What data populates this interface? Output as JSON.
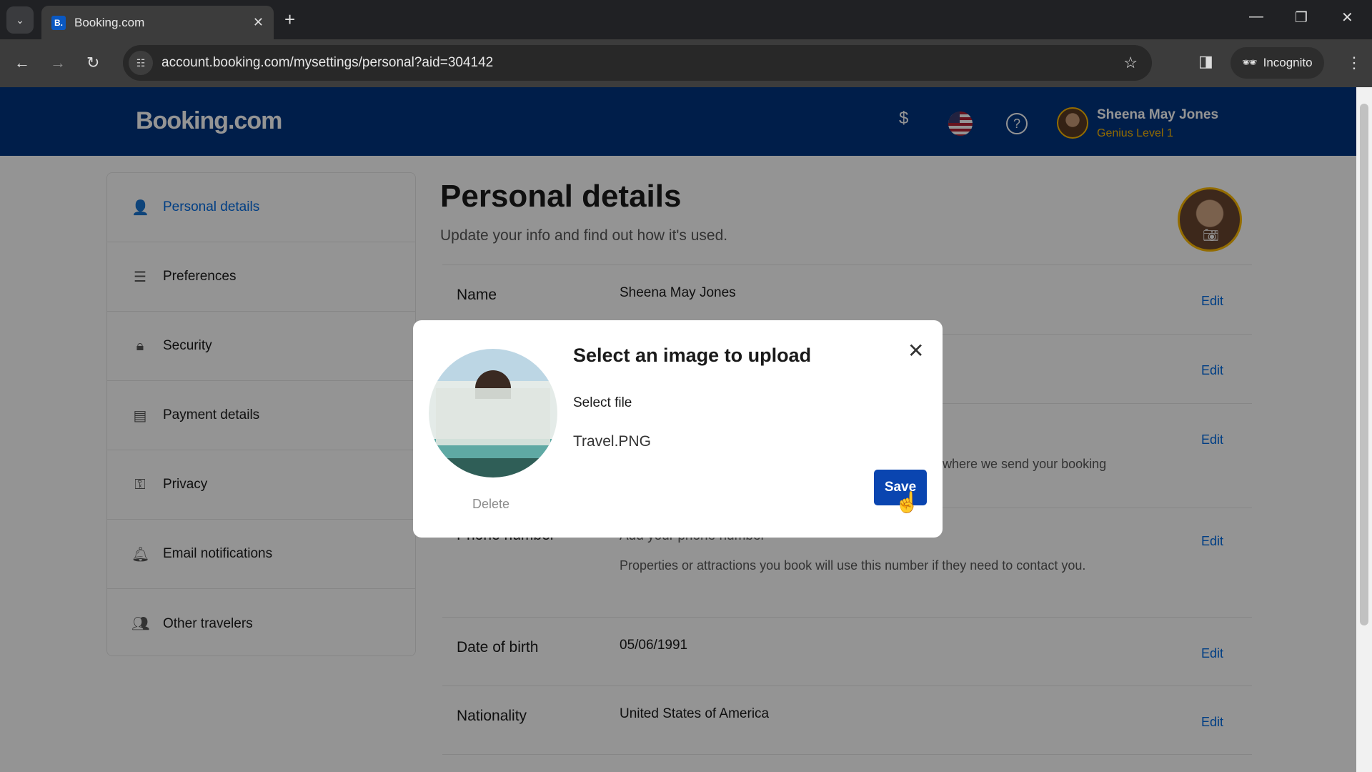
{
  "browser": {
    "tab_title": "Booking.com",
    "favicon": "B.",
    "url": "account.booking.com/mysettings/personal?aid=304142",
    "incognito_label": "Incognito"
  },
  "header": {
    "logo": "Booking.com",
    "currency": "$",
    "user_name": "Sheena May Jones",
    "user_level": "Genius Level 1",
    "brand_color": "#003580",
    "accent_color": "#febb02"
  },
  "sidebar": {
    "items": [
      {
        "label": "Personal details",
        "icon": "person-gear-icon",
        "active": true
      },
      {
        "label": "Preferences",
        "icon": "sliders-icon"
      },
      {
        "label": "Security",
        "icon": "lock-icon"
      },
      {
        "label": "Payment details",
        "icon": "card-icon"
      },
      {
        "label": "Privacy",
        "icon": "privacy-icon"
      },
      {
        "label": "Email notifications",
        "icon": "bell-icon"
      },
      {
        "label": "Other travelers",
        "icon": "people-icon"
      }
    ]
  },
  "main": {
    "title": "Personal details",
    "subtitle": "Update your info and find out how it's used.",
    "edit_label": "Edit",
    "rows": {
      "name": {
        "label": "Name",
        "value": "Sheena May Jones"
      },
      "email_desc": "where we send your booking",
      "phone": {
        "label": "Phone number",
        "value": "Add your phone number",
        "desc": "Properties or attractions you book will use this number if they need to contact you."
      },
      "dob": {
        "label": "Date of birth",
        "value": "05/06/1991"
      },
      "nationality": {
        "label": "Nationality",
        "value": "United States of America"
      }
    }
  },
  "modal": {
    "title": "Select an image to upload",
    "select_file": "Select file",
    "file_name": "Travel.PNG",
    "delete_label": "Delete",
    "save_label": "Save",
    "save_color": "#0a45b0"
  }
}
